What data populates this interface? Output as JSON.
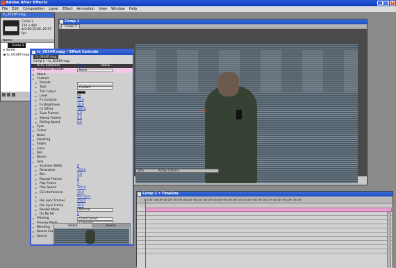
{
  "app": {
    "title": "Adobe After Effects"
  },
  "menu": [
    "File",
    "Edit",
    "Composition",
    "Layer",
    "Effect",
    "Animation",
    "View",
    "Window",
    "Help"
  ],
  "project_panel": {
    "tab_label": "tv_0034ff.mpg",
    "info_lines": [
      "Comp 1",
      "720 x 480",
      "Δ 0:00:15:00, 29.97 fps"
    ],
    "header": "Name",
    "items": [
      "Comp 1",
      "Solids",
      "tv_0034ff.mpg"
    ]
  },
  "comp_window": {
    "title": "Comp 1",
    "tab_label": "Comp 1",
    "toolbar_zoom": "50%",
    "toolbar_quality": "Active Camera"
  },
  "effect_controls": {
    "title": "tv_0034ff.mpg • Effect Controls",
    "header_lines": [
      "Comp 1 • tv_0034ff.mpg"
    ],
    "rows": [
      {
        "label": "fx  CC Scanlines",
        "value": "Reset",
        "extra": "About..."
      },
      {
        "label": "Animation Presets",
        "value": "None",
        "dd": true
      },
      {
        "label": "About"
      },
      {
        "label": "Controls"
      },
      {
        "label": "Presets",
        "value": "",
        "dd": true
      },
      {
        "label": "Type",
        "value": "Custom",
        "dd": true
      },
      {
        "label": "Tint Colour",
        "value": ""
      },
      {
        "label": "Level",
        "value": "80"
      },
      {
        "label": "Fx Contrast",
        "value": "75.0"
      },
      {
        "label": "Fx Brightness",
        "value": "20.0"
      },
      {
        "label": "Fx Offset",
        "value": "100.0"
      },
      {
        "label": "Scan Frames",
        "value": "4.0"
      },
      {
        "label": "Sweep Frames",
        "value": "6.0"
      },
      {
        "label": "Rolling Speed",
        "value": "6.0"
      },
      {
        "label": "Eyes"
      },
      {
        "label": "Colour"
      },
      {
        "label": "Noise"
      },
      {
        "label": "Ghosting"
      },
      {
        "label": "Edges"
      },
      {
        "label": "Lines"
      },
      {
        "label": "Roll"
      },
      {
        "label": "Bloom"
      },
      {
        "label": "Sine"
      },
      {
        "label": "Scanline Width",
        "value": "8"
      },
      {
        "label": "Resolution",
        "value": "100.0"
      },
      {
        "label": "Blur",
        "value": "1.0"
      },
      {
        "label": "Repeat Frames",
        "value": "8"
      },
      {
        "label": "Play Frame",
        "value": "1"
      },
      {
        "label": "Play Speed",
        "value": "100.0"
      },
      {
        "label": "CS Interference",
        "value": "10.0"
      },
      {
        "label": "",
        "value": "Pan Sync"
      },
      {
        "label": "Pan Sync Frames",
        "value": "450.0"
      },
      {
        "label": "Pan Sync Frame",
        "value": "40.0"
      },
      {
        "label": "Render Mode",
        "value": "Normal",
        "dd": true
      },
      {
        "label": "On No Sel",
        "value": "0"
      },
      {
        "label": "Filtering",
        "value": "ColorCorrect",
        "dd": true
      },
      {
        "label": "Preview Mode",
        "value": "Compose",
        "dd": true
      },
      {
        "label": "Blending"
      },
      {
        "label": "Source Cross"
      },
      {
        "label": "Source"
      }
    ],
    "preview_tabs": [
      "Output",
      "Source"
    ]
  },
  "timeline": {
    "title": "Comp 1 • Timeline",
    "ruler": [
      "00:15f",
      "00:15f",
      "00:15f",
      "00:15f",
      "00:15f",
      "00:15f",
      "00:15f",
      "00:15f",
      "00:15f",
      "00:15f",
      "00:15f",
      "00:15f",
      "00:15f",
      "00:15f",
      "00:15f",
      "00:15f"
    ]
  }
}
